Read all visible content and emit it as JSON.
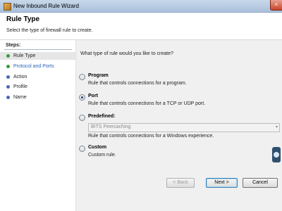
{
  "window": {
    "title": "New Inbound Rule Wizard",
    "close_glyph": "×"
  },
  "header": {
    "title": "Rule Type",
    "subtitle": "Select the type of firewall rule to create."
  },
  "steps": {
    "heading": "Steps:",
    "items": [
      {
        "label": "Rule Type",
        "state": "current",
        "dot_color": "#3a9a3a"
      },
      {
        "label": "Protocol and Ports",
        "state": "link",
        "dot_color": "#3a9a3a"
      },
      {
        "label": "Action",
        "state": "pending",
        "dot_color": "#4a6ab0"
      },
      {
        "label": "Profile",
        "state": "pending",
        "dot_color": "#4a6ab0"
      },
      {
        "label": "Name",
        "state": "pending",
        "dot_color": "#4a6ab0"
      }
    ]
  },
  "main": {
    "question": "What type of rule would you like to create?",
    "options": [
      {
        "title": "Program",
        "description": "Rule that controls connections for a program.",
        "checked": false
      },
      {
        "title": "Port",
        "description": "Rule that controls connections for a TCP or UDP port.",
        "checked": true
      },
      {
        "title": "Predefined:",
        "description": "Rule that controls connections for a Windows experience.",
        "checked": false
      },
      {
        "title": "Custom",
        "description": "Custom rule.",
        "checked": false
      }
    ],
    "predefined_select": {
      "value": "BITS Peercaching",
      "arrow": "▾"
    }
  },
  "buttons": {
    "back": "< Back",
    "next": "Next >",
    "cancel": "Cancel"
  }
}
